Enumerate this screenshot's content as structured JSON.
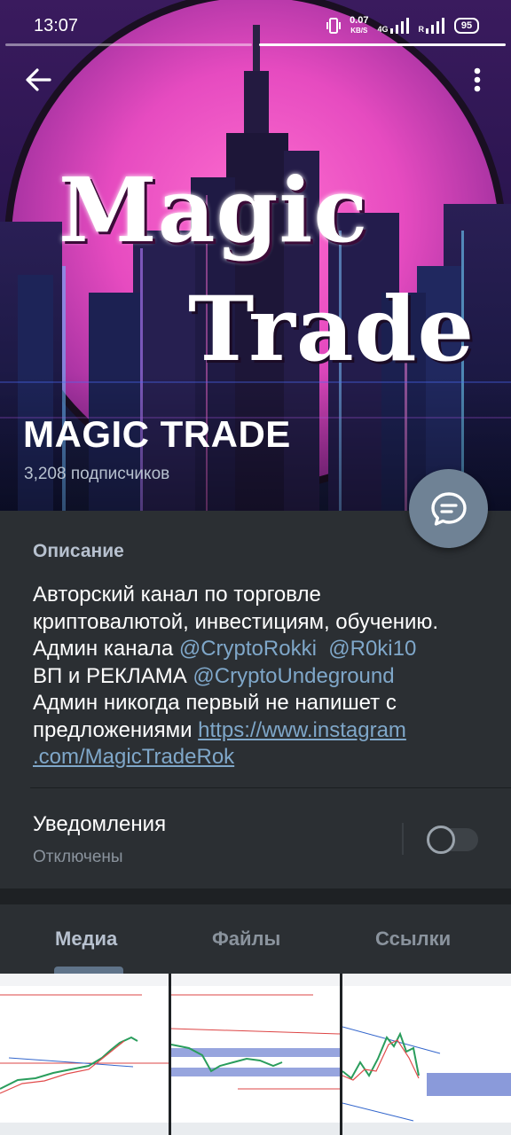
{
  "status_bar": {
    "time": "13:07",
    "net_speed": "0.07",
    "net_unit": "KB/S",
    "net_type": "4G",
    "roaming": "R",
    "battery": "95"
  },
  "header": {
    "logo_line1": "Magic",
    "logo_line2": "Trade",
    "title": "MAGIC TRADE",
    "subscribers": "3,208 подписчиков"
  },
  "icons": {
    "back": "arrow-left-icon",
    "menu": "more-vertical-icon",
    "fab": "chat-bubble-icon"
  },
  "info": {
    "description_label": "Описание",
    "description": {
      "line1": "Авторский канал по торговле",
      "line2": "криптовалютой, инвестициям, обучению.",
      "line3_prefix": "Админ канала ",
      "mention1": "@CryptoRokki",
      "mention2": "@R0ki10",
      "line4_prefix": "ВП и РЕКЛАМА ",
      "mention3": "@CryptoUndeground",
      "line5": "Админ никогда первый не напишет с",
      "line6_prefix": "предложениями ",
      "url_part1": "https://www.instagram",
      "url_part2": ".com/MagicTradeRok"
    },
    "notifications_label": "Уведомления",
    "notifications_status": "Отключены",
    "notifications_enabled": false
  },
  "tabs": [
    {
      "label": "Медиа",
      "active": true
    },
    {
      "label": "Файлы",
      "active": false
    },
    {
      "label": "Ссылки",
      "active": false
    }
  ],
  "colors": {
    "background": "#1e2124",
    "panel": "#2b2f33",
    "link": "#7fa7c9",
    "accent": "#5f7389",
    "fab": "#6f8295"
  }
}
